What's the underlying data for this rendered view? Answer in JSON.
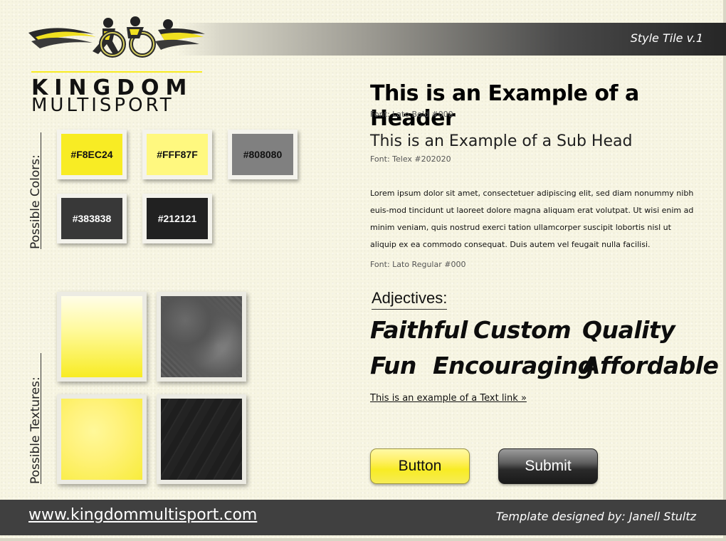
{
  "header": {
    "style_tile_label": "Style Tile  v.1"
  },
  "logo": {
    "line1": "KINGDOM",
    "line2": "MULTISPORT"
  },
  "labels": {
    "colors": "Possible Colors:",
    "textures": "Possible Textures:"
  },
  "colors": [
    {
      "hex": "#F8EC24",
      "text_color": "#111111"
    },
    {
      "hex": "#FFF87F",
      "text_color": "#111111"
    },
    {
      "hex": "#808080",
      "text_color": "#111111"
    },
    {
      "hex": "#383838",
      "text_color": "#ffffff"
    },
    {
      "hex": "#212121",
      "text_color": "#ffffff"
    }
  ],
  "typography": {
    "header": "This is an Example of a Header",
    "header_note": "Font: Lato Bold #000",
    "subhead": "This is an Example of a Sub Head",
    "subhead_note": "Font: Telex #202020",
    "body": "Lorem ipsum dolor sit amet, consectetuer adipiscing elit, sed diam nonummy nibh euis-mod tincidunt ut laoreet dolore magna aliquam erat volutpat. Ut wisi enim ad minim veniam, quis nostrud exerci tation ullamcorper suscipit lobortis nisl ut aliquip ex ea commodo consequat. Duis autem vel feugait nulla facilisi.",
    "body_note": "Font: Lato Regular #000"
  },
  "adjectives": {
    "title": "Adjectives:",
    "words": [
      "Faithful",
      "Custom",
      "Quality",
      "Fun",
      "Encouraging",
      "Affordable"
    ]
  },
  "text_link": "This is an example of a Text link »",
  "buttons": {
    "primary": "Button",
    "submit": "Submit"
  },
  "footer": {
    "url": "www.kingdommultisport.com",
    "credit": "Template designed by: Janell Stultz"
  },
  "theme": {
    "accent": "#F8EC24",
    "footer_bg": "#404040"
  }
}
